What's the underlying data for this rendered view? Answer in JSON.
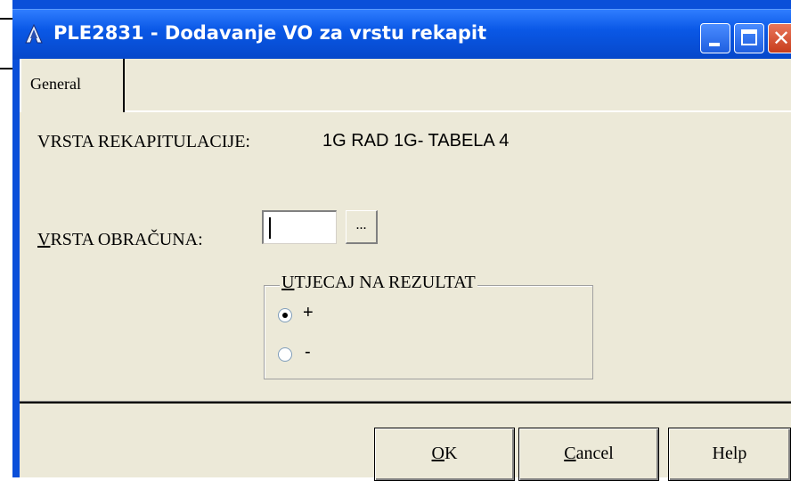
{
  "window": {
    "title": "PLE2831 - Dodavanje VO za vrstu rekapit",
    "controls": [
      "minimize",
      "maximize",
      "close"
    ]
  },
  "tabs": [
    {
      "label": "General"
    }
  ],
  "form": {
    "recap_label": "VRSTA REKAPITULACIJE:",
    "recap_value": "1G RAD 1G- TABELA 4",
    "calc_label_accel": "V",
    "calc_label_rest": "RSTA OBRAČUNA:",
    "calc_value": "",
    "browse_label": "..."
  },
  "group": {
    "title_accel": "U",
    "title_rest": "TJECAJ NA REZULTAT",
    "options": [
      {
        "label": "+",
        "checked": true
      },
      {
        "label": "-",
        "checked": false
      }
    ]
  },
  "buttons": {
    "ok_accel": "O",
    "ok_rest": "K",
    "cancel_accel": "C",
    "cancel_rest": "ancel",
    "help": "Help"
  },
  "colors": {
    "titlebar": "#0a58e6",
    "dialog_bg": "#ece9d8"
  }
}
